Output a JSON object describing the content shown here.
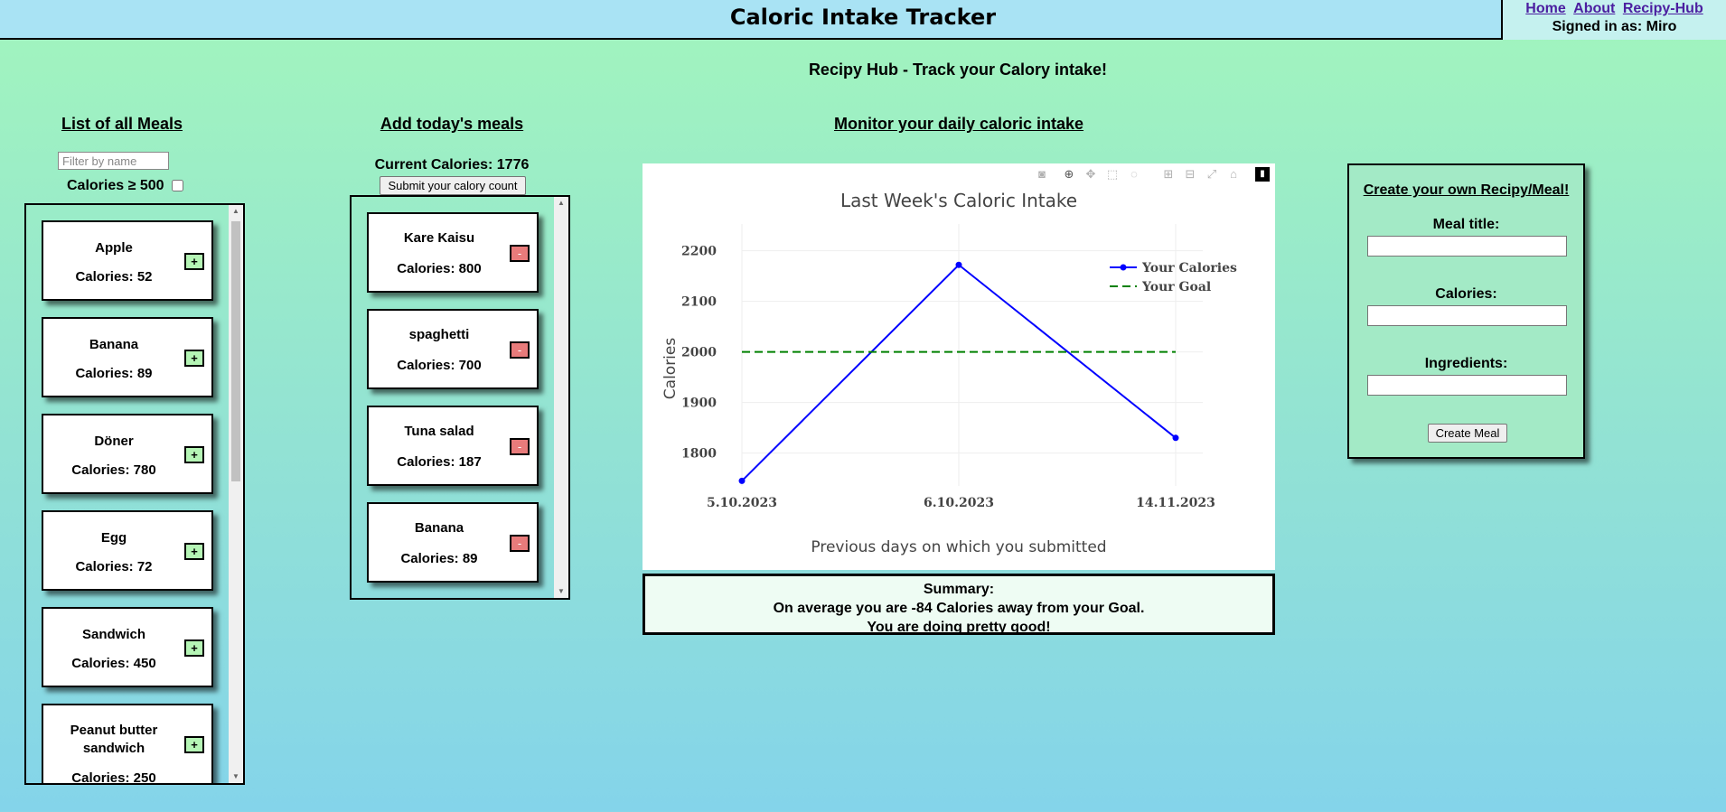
{
  "header": {
    "title": "Caloric Intake Tracker",
    "nav": [
      "Home",
      "About",
      "Recipy-Hub"
    ],
    "signed_in": "Signed in as: Miro"
  },
  "subtitle": "Recipy Hub - Track your Calory intake!",
  "meals_list": {
    "heading": "List of all Meals",
    "filter_placeholder": "Filter by name",
    "calorie_filter_label": "Calories ≥ 500",
    "add_label": "+",
    "items": [
      {
        "name": "Apple",
        "calories": "Calories: 52"
      },
      {
        "name": "Banana",
        "calories": "Calories: 89"
      },
      {
        "name": "Döner",
        "calories": "Calories: 780"
      },
      {
        "name": "Egg",
        "calories": "Calories: 72"
      },
      {
        "name": "Sandwich",
        "calories": "Calories: 450"
      },
      {
        "name": "Peanut butter sandwich",
        "calories": "Calories: 250"
      }
    ]
  },
  "today": {
    "heading": "Add today's meals",
    "current": "Current Calories: 1776",
    "submit_label": "Submit your calory count",
    "remove_label": "-",
    "items": [
      {
        "name": "Kare Kaisu",
        "calories": "Calories: 800"
      },
      {
        "name": "spaghetti",
        "calories": "Calories: 700"
      },
      {
        "name": "Tuna salad",
        "calories": "Calories: 187"
      },
      {
        "name": "Banana",
        "calories": "Calories: 89"
      }
    ]
  },
  "monitor": {
    "heading": "Monitor your daily caloric intake"
  },
  "chart_data": {
    "type": "line",
    "title": "Last Week's Caloric Intake",
    "xlabel": "Previous days on which you submitted",
    "ylabel": "Calories",
    "categories": [
      "5.10.2023",
      "6.10.2023",
      "14.11.2023"
    ],
    "yticks": [
      1800,
      1900,
      2000,
      2100,
      2200
    ],
    "ylim": [
      1735,
      2235
    ],
    "grid": true,
    "legend_position": "top-right",
    "series": [
      {
        "name": "Your Calories",
        "values": [
          1745,
          2172,
          1830
        ],
        "color": "#0000ff",
        "style": "solid-markers"
      },
      {
        "name": "Your Goal",
        "values": [
          2000,
          2000,
          2000
        ],
        "color": "#008000",
        "style": "dashed"
      }
    ]
  },
  "summary": {
    "title": "Summary:",
    "line1": "On average you are -84 Calories away from your Goal.",
    "line2": "You are doing pretty good!"
  },
  "create": {
    "title": "Create your own Recipy/Meal!",
    "meal_title_label": "Meal title:",
    "calories_label": "Calories:",
    "ingredients_label": "Ingredients:",
    "button_label": "Create Meal"
  },
  "colors": {
    "accent_green": "#b5f5b5",
    "remove_red": "#e87b7b",
    "header_bg": "#a9e3f4"
  }
}
